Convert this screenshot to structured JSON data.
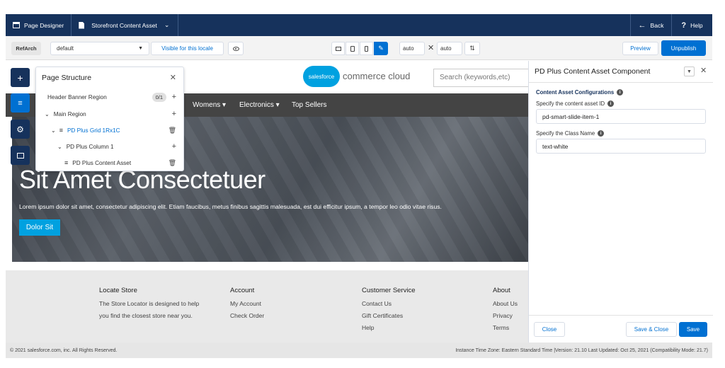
{
  "topbar": {
    "page_designer": "Page Designer",
    "asset_selector": "Storefront Content Asset",
    "back": "Back",
    "help": "Help"
  },
  "toolbar": {
    "site": "RefArch",
    "locale": "default",
    "visible_locale": "Visible for this locale",
    "width": "auto",
    "height": "auto",
    "preview": "Preview",
    "unpublish": "Unpublish"
  },
  "storefront": {
    "logo_badge": "salesforce",
    "logo_text": "commerce cloud",
    "search_placeholder": "Search (keywords,etc)",
    "nav": [
      "Womens",
      "Electronics",
      "Top Sellers"
    ],
    "hero_title": "Sit Amet Consectetuer",
    "hero_text": "Lorem ipsum dolor sit amet, consectetur adipiscing elit. Etiam faucibus, metus finibus sagittis malesuada, est dui efficitur ipsum, a tempor leo odio vitae risus.",
    "hero_button": "Dolor Sit",
    "footer": {
      "locate": {
        "title": "Locate Store",
        "line1": "The Store Locator is designed to help",
        "line2": "you find the closest store near you."
      },
      "account": {
        "title": "Account",
        "items": [
          "My Account",
          "Check Order"
        ]
      },
      "service": {
        "title": "Customer Service",
        "items": [
          "Contact Us",
          "Gift Certificates",
          "Help"
        ]
      },
      "about": {
        "title": "About",
        "items": [
          "About Us",
          "Privacy",
          "Terms"
        ]
      }
    }
  },
  "page_structure": {
    "title": "Page Structure",
    "rows": [
      {
        "label": "Header Banner Region",
        "count": "0/1"
      },
      {
        "label": "Main Region"
      },
      {
        "label": "PD Plus Grid 1Rx1C"
      },
      {
        "label": "PD Plus Column 1"
      },
      {
        "label": "PD Plus Content Asset"
      }
    ]
  },
  "right_panel": {
    "title": "PD Plus Content Asset Component",
    "section": "Content Asset Configurations",
    "asset_id_label": "Specify the content asset ID",
    "asset_id_value": "pd-smart-slide-item-1",
    "class_label": "Specify the Class Name",
    "class_value": "text-white",
    "close": "Close",
    "save_close": "Save & Close",
    "save": "Save"
  },
  "copyright": "© 2021 salesforce.com, inc. All Rights Reserved.",
  "instance_info": "Instance Time Zone: Eastern Standard Time |Version: 21.10 Last Updated: Oct 25, 2021 (Compatibility Mode: 21.7)",
  "colors": {
    "brand": "#0070d2",
    "header": "#16325c",
    "accent": "#00a1e0"
  }
}
